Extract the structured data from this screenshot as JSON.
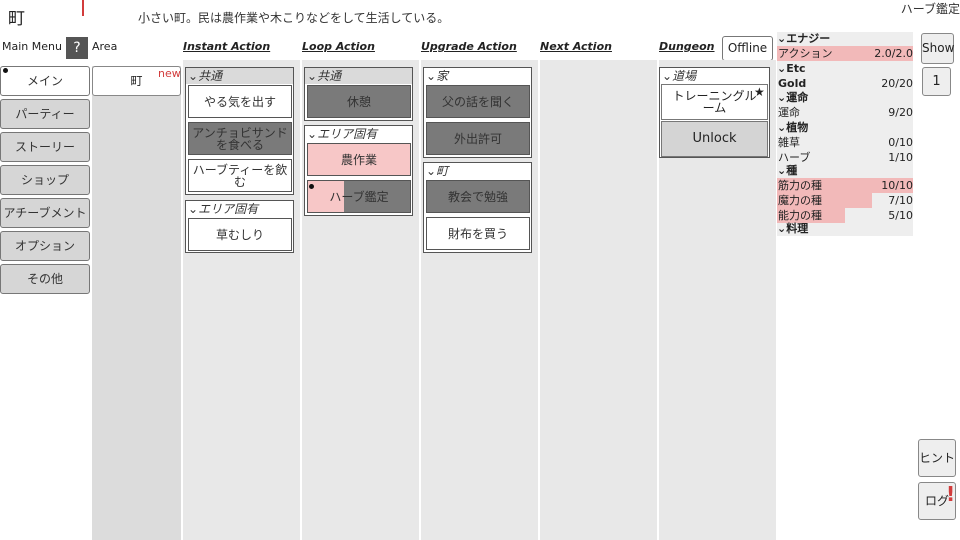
{
  "header": {
    "title": "町",
    "description": "小さい町。民は農作業や木こりなどをして生活している。",
    "current_action": "ハーブ鑑定"
  },
  "columns": {
    "main_menu": "Main Menu",
    "help": "?",
    "area": "Area",
    "instant": "Instant Action",
    "loop": "Loop Action",
    "upgrade": "Upgrade Action",
    "next": "Next Action",
    "dungeon": "Dungeon"
  },
  "menu": [
    "メイン",
    "パーティー",
    "ストーリー",
    "ショップ",
    "アチーブメント",
    "オプション",
    "その他"
  ],
  "area": {
    "town": "町",
    "new_tag": "new"
  },
  "instant": {
    "g1_title": "共通",
    "g1_items": [
      "やる気を出す",
      "アンチョビサンドを食べる",
      "ハーブティーを飲む"
    ],
    "g2_title": "エリア固有",
    "g2_items": [
      "草むしり"
    ]
  },
  "loop": {
    "g1_title": "共通",
    "g1_items": [
      "休憩"
    ],
    "g2_title": "エリア固有",
    "g2_items": [
      "農作業",
      "ハーブ鑑定"
    ],
    "progress": {
      "herb_appraisal": 0.35
    }
  },
  "upgrade": {
    "g1_title": "家",
    "g1_items": [
      "父の話を聞く",
      "外出許可"
    ],
    "g2_title": "町",
    "g2_items": [
      "教会で勉強",
      "財布を買う"
    ]
  },
  "dungeon": {
    "offline": "Offline",
    "group_title": "道場",
    "training_room": "トレーニングルーム",
    "star": "★",
    "unlock": "Unlock"
  },
  "resources": {
    "energy_head": "エナジー",
    "action": {
      "label": "アクション",
      "value": "2.0/2.0",
      "fill": 1.0
    },
    "etc_head": "Etc",
    "gold": {
      "label": "Gold",
      "value": "20/20"
    },
    "fortune_head": "運命",
    "fortune": {
      "label": "運命",
      "value": "9/20"
    },
    "plant_head": "植物",
    "weeds": {
      "label": "雑草",
      "value": "0/10"
    },
    "herb": {
      "label": "ハーブ",
      "value": "1/10"
    },
    "seed_head": "種",
    "str_seed": {
      "label": "筋力の種",
      "value": "10/10",
      "fill": 1.0
    },
    "mag_seed": {
      "label": "魔力の種",
      "value": "7/10",
      "fill": 0.7
    },
    "abl_seed": {
      "label": "能力の種",
      "value": "5/10",
      "fill": 0.5
    },
    "cook_head": "料理"
  },
  "side": {
    "show": "Show",
    "count": "1",
    "hint": "ヒント",
    "log": "ログ",
    "log_alert": "!"
  },
  "icons": {
    "chevron": "chevron-down-icon",
    "dot": "dot-indicator-icon"
  }
}
